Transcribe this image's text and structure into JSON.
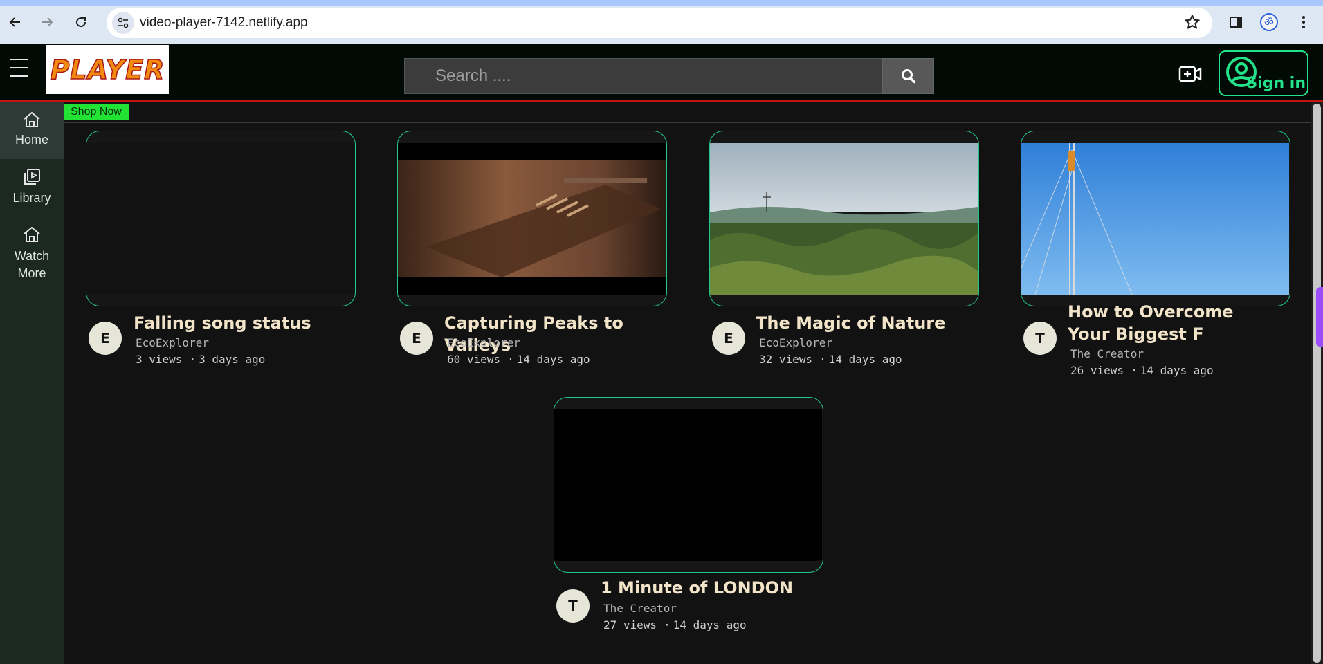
{
  "browser": {
    "url": "video-player-7142.netlify.app"
  },
  "header": {
    "logo_text": "PLAYER",
    "search_placeholder": "Search ....",
    "signin_label": "Sign in"
  },
  "sidebar": {
    "items": [
      {
        "label": "Home",
        "icon": "home-icon"
      },
      {
        "label": "Library",
        "icon": "library-icon"
      },
      {
        "label": "Watch More",
        "icon": "home-icon"
      }
    ]
  },
  "shop": {
    "label": "Shop Now"
  },
  "videos": [
    {
      "title": "Falling song status",
      "channel": "EcoExplorer",
      "initial": "E",
      "views": "3 views",
      "age": "3 days ago"
    },
    {
      "title": "Capturing Peaks to Valleys",
      "channel": "EcoExplorer",
      "initial": "E",
      "views": "60 views",
      "age": "14 days ago"
    },
    {
      "title": "The Magic of Nature",
      "channel": "EcoExplorer",
      "initial": "E",
      "views": "32 views",
      "age": "14 days ago"
    },
    {
      "title": "How to Overcome Your Biggest F",
      "channel": "The Creator",
      "initial": "T",
      "views": "26 views",
      "age": "14 days ago"
    },
    {
      "title": "1 Minute of LONDON",
      "channel": "The Creator",
      "initial": "T",
      "views": "27 views",
      "age": "14 days ago"
    }
  ],
  "colors": {
    "accent": "#22e38a",
    "shop_bg": "#22e333",
    "header_border": "#c41515"
  }
}
